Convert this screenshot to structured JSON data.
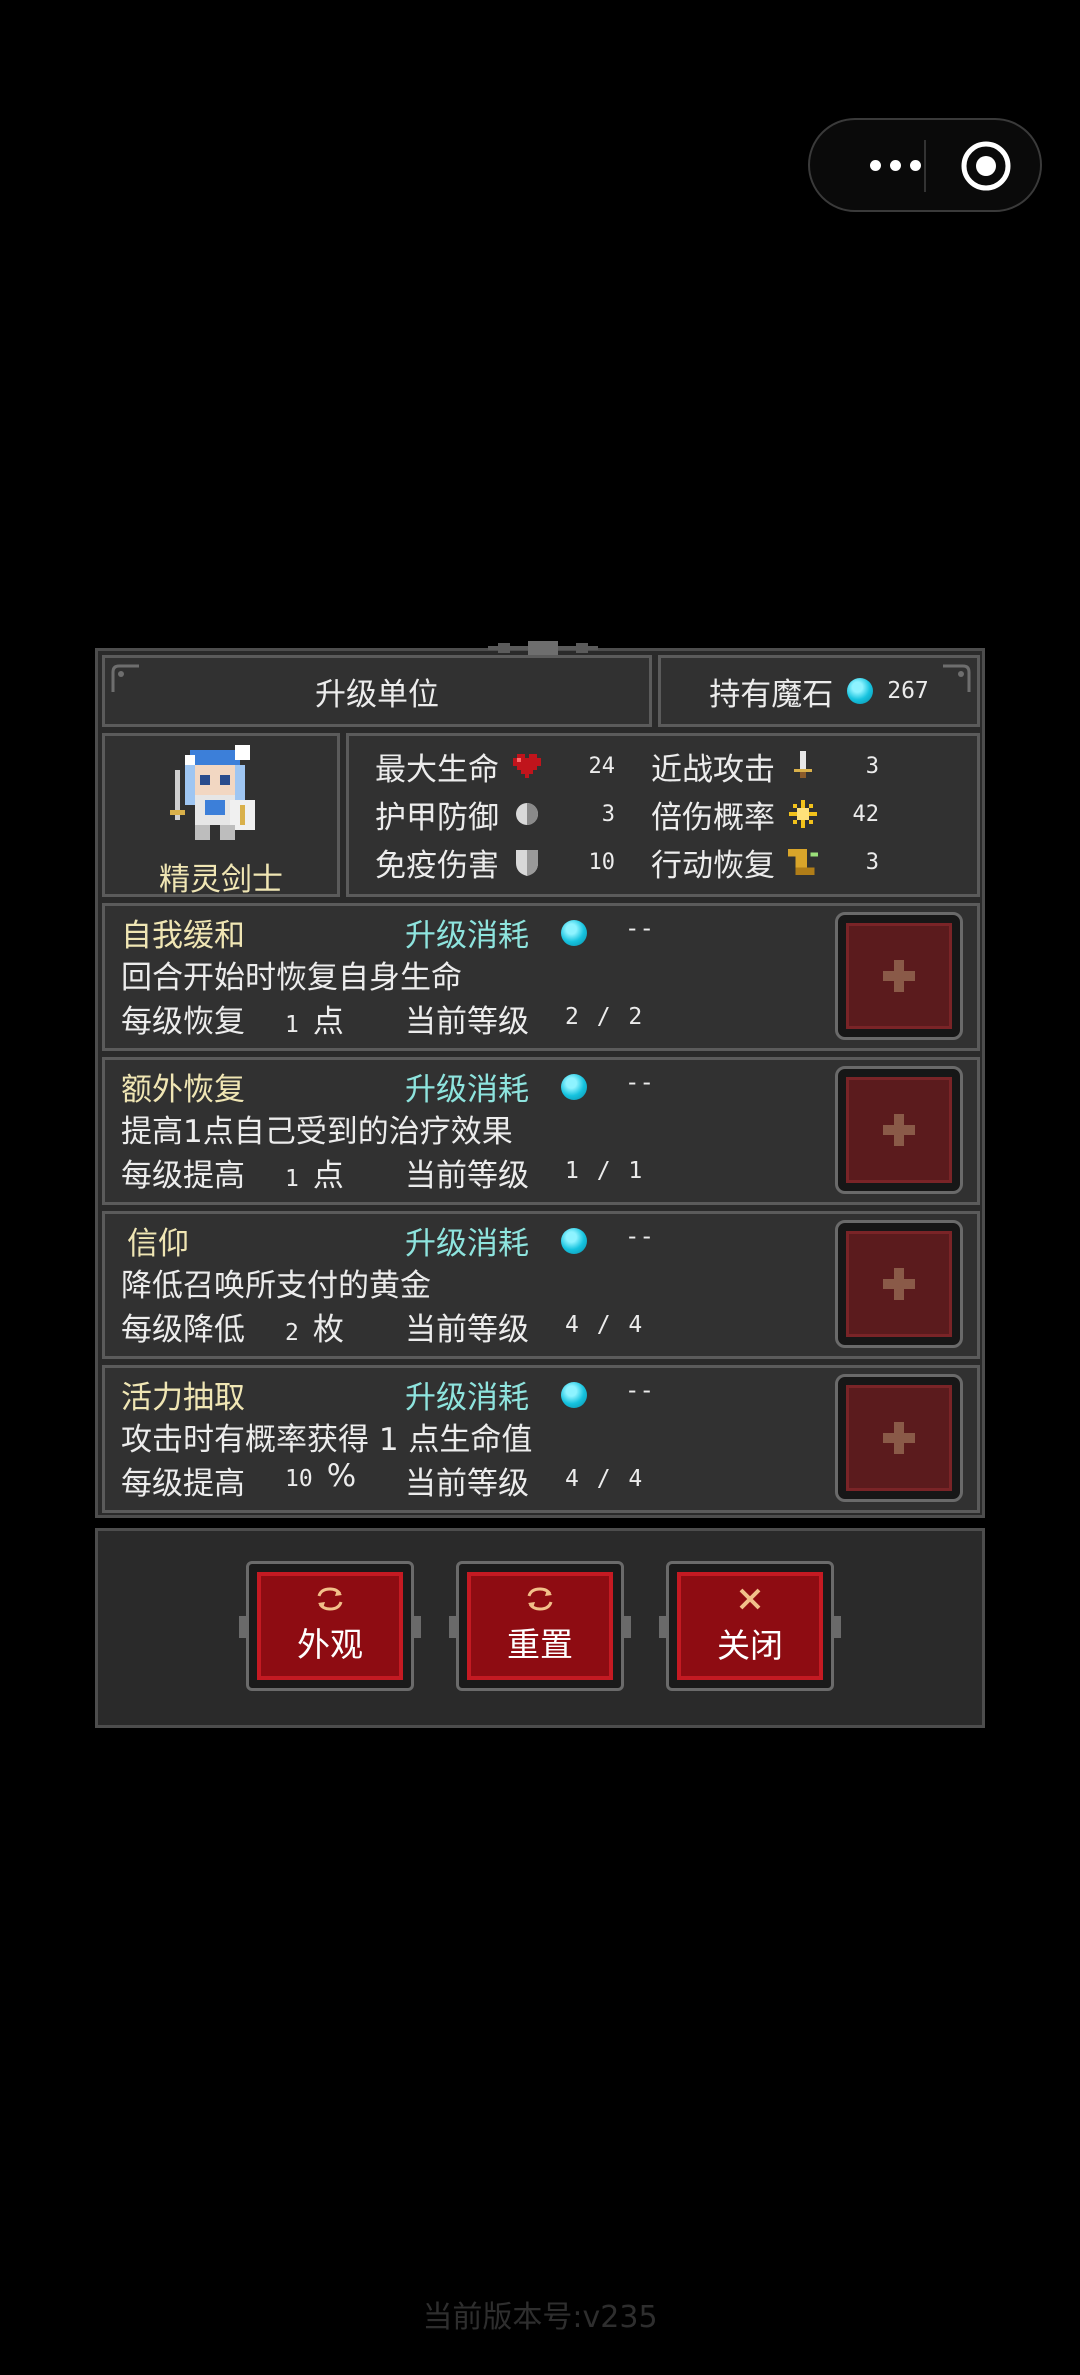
{
  "header": {
    "title": "升级单位"
  },
  "currency": {
    "label": "持有魔石",
    "value": "267",
    "icon": "magic-stone-gem-icon",
    "color": "#16c3df"
  },
  "unit": {
    "name": "精灵剑士",
    "icon": "elf-swordsman-sprite"
  },
  "stats": [
    {
      "label": "最大生命",
      "icon": "heart-icon",
      "value": "24"
    },
    {
      "label": "护甲防御",
      "icon": "armor-orb-icon",
      "value": "3"
    },
    {
      "label": "免疫伤害",
      "icon": "shield-icon",
      "value": "10"
    },
    {
      "label": "近战攻击",
      "icon": "sword-icon",
      "value": "3"
    },
    {
      "label": "倍伤概率",
      "icon": "crit-star-icon",
      "value": "42"
    },
    {
      "label": "行动恢复",
      "icon": "boot-icon",
      "value": "3"
    }
  ],
  "cost_label": "升级消耗",
  "level_label": "当前等级",
  "skills": [
    {
      "name": "自我缓和",
      "cost": "--",
      "desc": "回合开始时恢复自身生命",
      "per_label": "每级恢复",
      "per_num": "1",
      "per_unit": "点",
      "level": "2 / 2"
    },
    {
      "name": "额外恢复",
      "cost": "--",
      "desc": "提高1点自己受到的治疗效果",
      "per_label": "每级提高",
      "per_num": "1",
      "per_unit": "点",
      "level": "1 / 1"
    },
    {
      "name": "信仰",
      "cost": "--",
      "desc": "降低召唤所支付的黄金",
      "per_label": "每级降低",
      "per_num": "2",
      "per_unit": "枚",
      "level": "4 / 4"
    },
    {
      "name": "活力抽取",
      "cost": "--",
      "desc": "攻击时有概率获得 1 点生命值",
      "per_label": "每级提高",
      "per_num": "10",
      "per_unit": "%",
      "level": "4 / 4"
    }
  ],
  "buttons": {
    "appearance": "外观",
    "reset": "重置",
    "close": "关闭"
  },
  "version": "当前版本号:v235",
  "colors": {
    "background": "#000000",
    "panel": "#313131",
    "button_red": "#8e0c12",
    "gold_text": "#f0e6b4",
    "cyan_text": "#8ee4de"
  }
}
